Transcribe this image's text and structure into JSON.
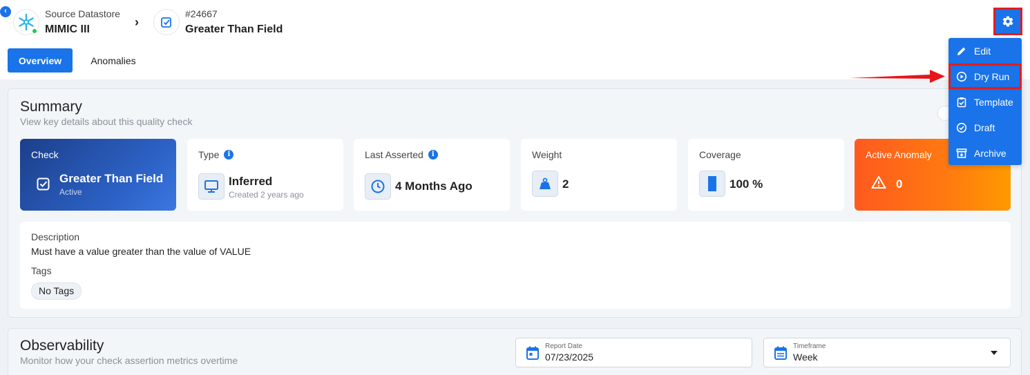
{
  "header": {
    "datastore_label": "Source Datastore",
    "datastore_name": "MIMIC III",
    "check_id": "#24667",
    "check_name": "Greater Than Field"
  },
  "tabs": [
    {
      "label": "Overview",
      "active": true
    },
    {
      "label": "Anomalies",
      "active": false
    }
  ],
  "menu": {
    "items": [
      {
        "label": "Edit",
        "icon": "pencil-icon"
      },
      {
        "label": "Dry Run",
        "icon": "play-circle-icon",
        "highlighted": true
      },
      {
        "label": "Template",
        "icon": "clipboard-check-icon"
      },
      {
        "label": "Draft",
        "icon": "check-circle-icon"
      },
      {
        "label": "Archive",
        "icon": "archive-icon"
      }
    ]
  },
  "summary": {
    "title": "Summary",
    "subtitle": "View key details about this quality check",
    "cards": {
      "check": {
        "label": "Check",
        "value": "Greater Than Field",
        "status": "Active"
      },
      "type": {
        "label": "Type",
        "value": "Inferred",
        "sub": "Created 2 years ago"
      },
      "last_asserted": {
        "label": "Last Asserted",
        "value": "4 Months Ago"
      },
      "weight": {
        "label": "Weight",
        "value": "2"
      },
      "coverage": {
        "label": "Coverage",
        "value": "100 %"
      },
      "active_anomaly": {
        "label": "Active Anomaly",
        "value": "0"
      }
    },
    "description_label": "Description",
    "description": "Must have a value greater than the value of VALUE",
    "tags_label": "Tags",
    "tags_empty": "No Tags"
  },
  "observability": {
    "title": "Observability",
    "subtitle": "Monitor how your check assertion metrics overtime",
    "report_date_label": "Report Date",
    "report_date": "07/23/2025",
    "timeframe_label": "Timeframe",
    "timeframe": "Week"
  },
  "colors": {
    "primary": "#1a73e8",
    "highlight": "#e11d1d",
    "anomaly": "#ff7a10",
    "status_online": "#22c55e"
  }
}
